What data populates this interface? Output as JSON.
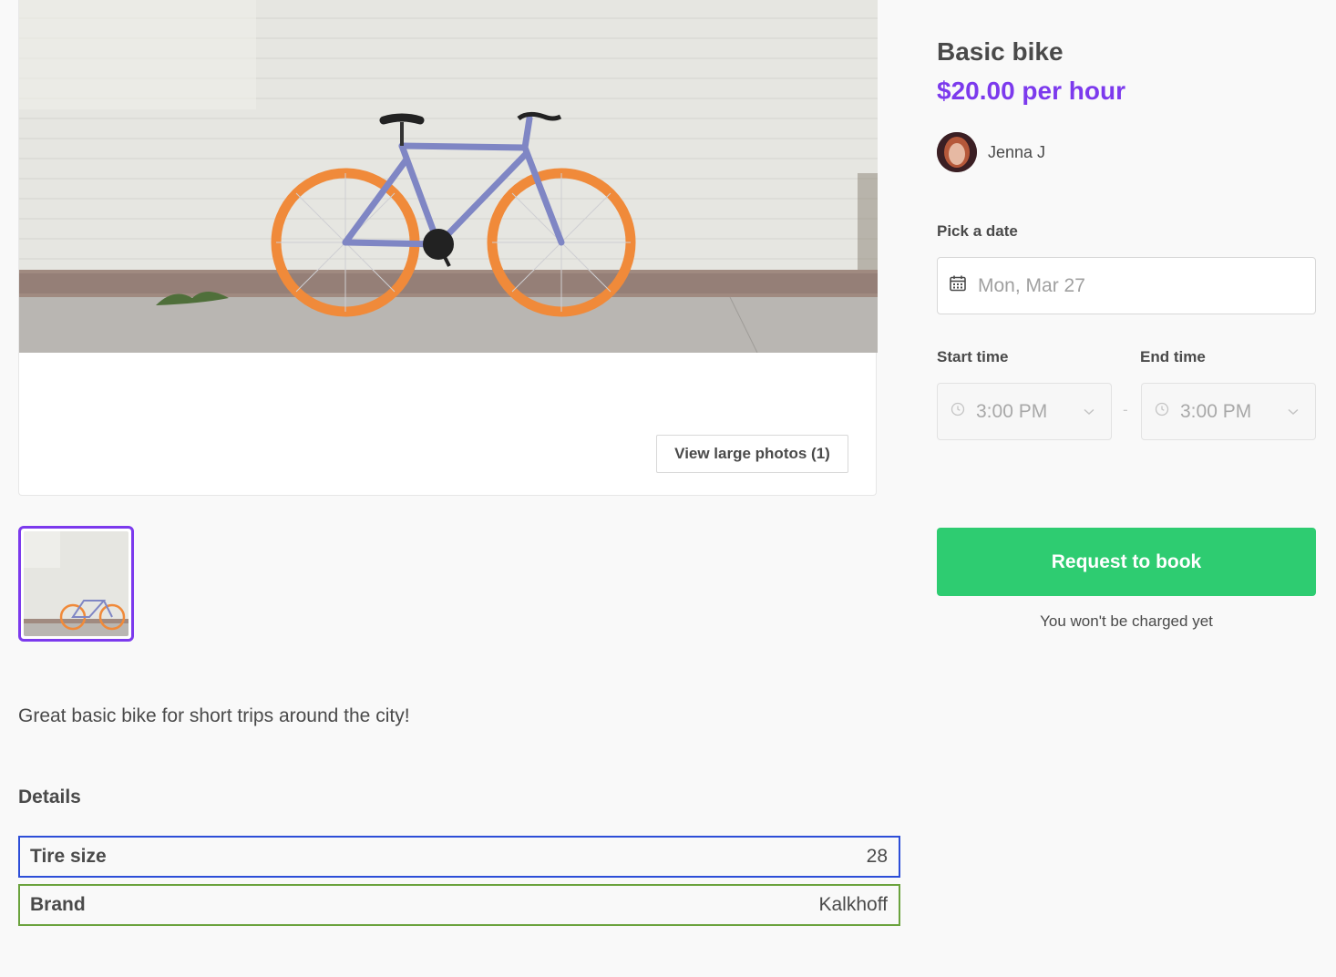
{
  "listing": {
    "title": "Basic bike",
    "price": "$20.00",
    "price_unit": "per hour",
    "author_name": "Jenna J",
    "description": "Great basic bike for short trips around the city!"
  },
  "gallery": {
    "view_photos_label": "View large photos (1)"
  },
  "booking": {
    "date_label": "Pick a date",
    "date_value": "Mon, Mar 27",
    "start_label": "Start time",
    "start_value": "3:00 PM",
    "end_label": "End time",
    "end_value": "3:00 PM",
    "separator": "-",
    "submit_label": "Request to book",
    "note": "You won't be charged yet"
  },
  "details": {
    "title": "Details",
    "rows": [
      {
        "label": "Tire size",
        "value": "28"
      },
      {
        "label": "Brand",
        "value": "Kalkhoff"
      }
    ]
  },
  "icons": {
    "date": "calendar-icon",
    "time": "clock-icon",
    "dropdown": "chevron-down-icon"
  },
  "colors": {
    "accent": "#7c3aed",
    "book_button": "#2ecc71",
    "tire_row_border": "#2d4ed8",
    "brand_row_border": "#6ba33e"
  }
}
